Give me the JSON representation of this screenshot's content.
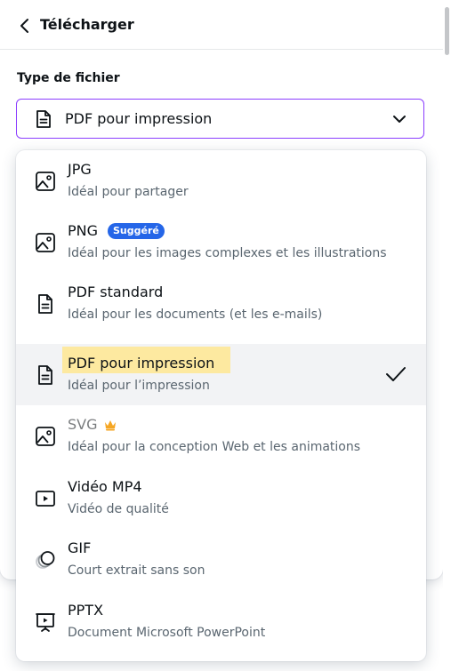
{
  "header": {
    "back_icon": "chevron-left-icon",
    "title": "Télécharger"
  },
  "file_type": {
    "label": "Type de fichier",
    "selected_value": "PDF pour impression",
    "icon": "document-icon",
    "chevron": "chevron-down-icon"
  },
  "options": [
    {
      "title": "JPG",
      "description": "Idéal pour partager",
      "icon": "image-icon"
    },
    {
      "title": "PNG",
      "description": "Idéal pour les images complexes et les illustrations",
      "icon": "image-icon",
      "badge": "Suggéré"
    },
    {
      "title": "PDF standard",
      "description": "Idéal pour les documents (et les e-mails)",
      "icon": "document-icon"
    },
    {
      "title": "PDF pour impression",
      "description": "Idéal pour l’impression",
      "icon": "document-icon",
      "selected": true
    },
    {
      "title": "SVG",
      "description": "Idéal pour la conception Web et les animations",
      "icon": "image-icon",
      "premium": true
    },
    {
      "title": "Vidéo MP4",
      "description": "Vidéo de qualité",
      "icon": "video-icon"
    },
    {
      "title": "GIF",
      "description": "Court extrait sans son",
      "icon": "gif-icon"
    },
    {
      "title": "PPTX",
      "description": "Document Microsoft PowerPoint",
      "icon": "presentation-icon"
    }
  ],
  "colors": {
    "accent": "#8b3dff",
    "badge": "#2566e8",
    "highlight": "#fde9a0",
    "crown": "#f5a623",
    "selected_row": "#f2f3f5"
  }
}
